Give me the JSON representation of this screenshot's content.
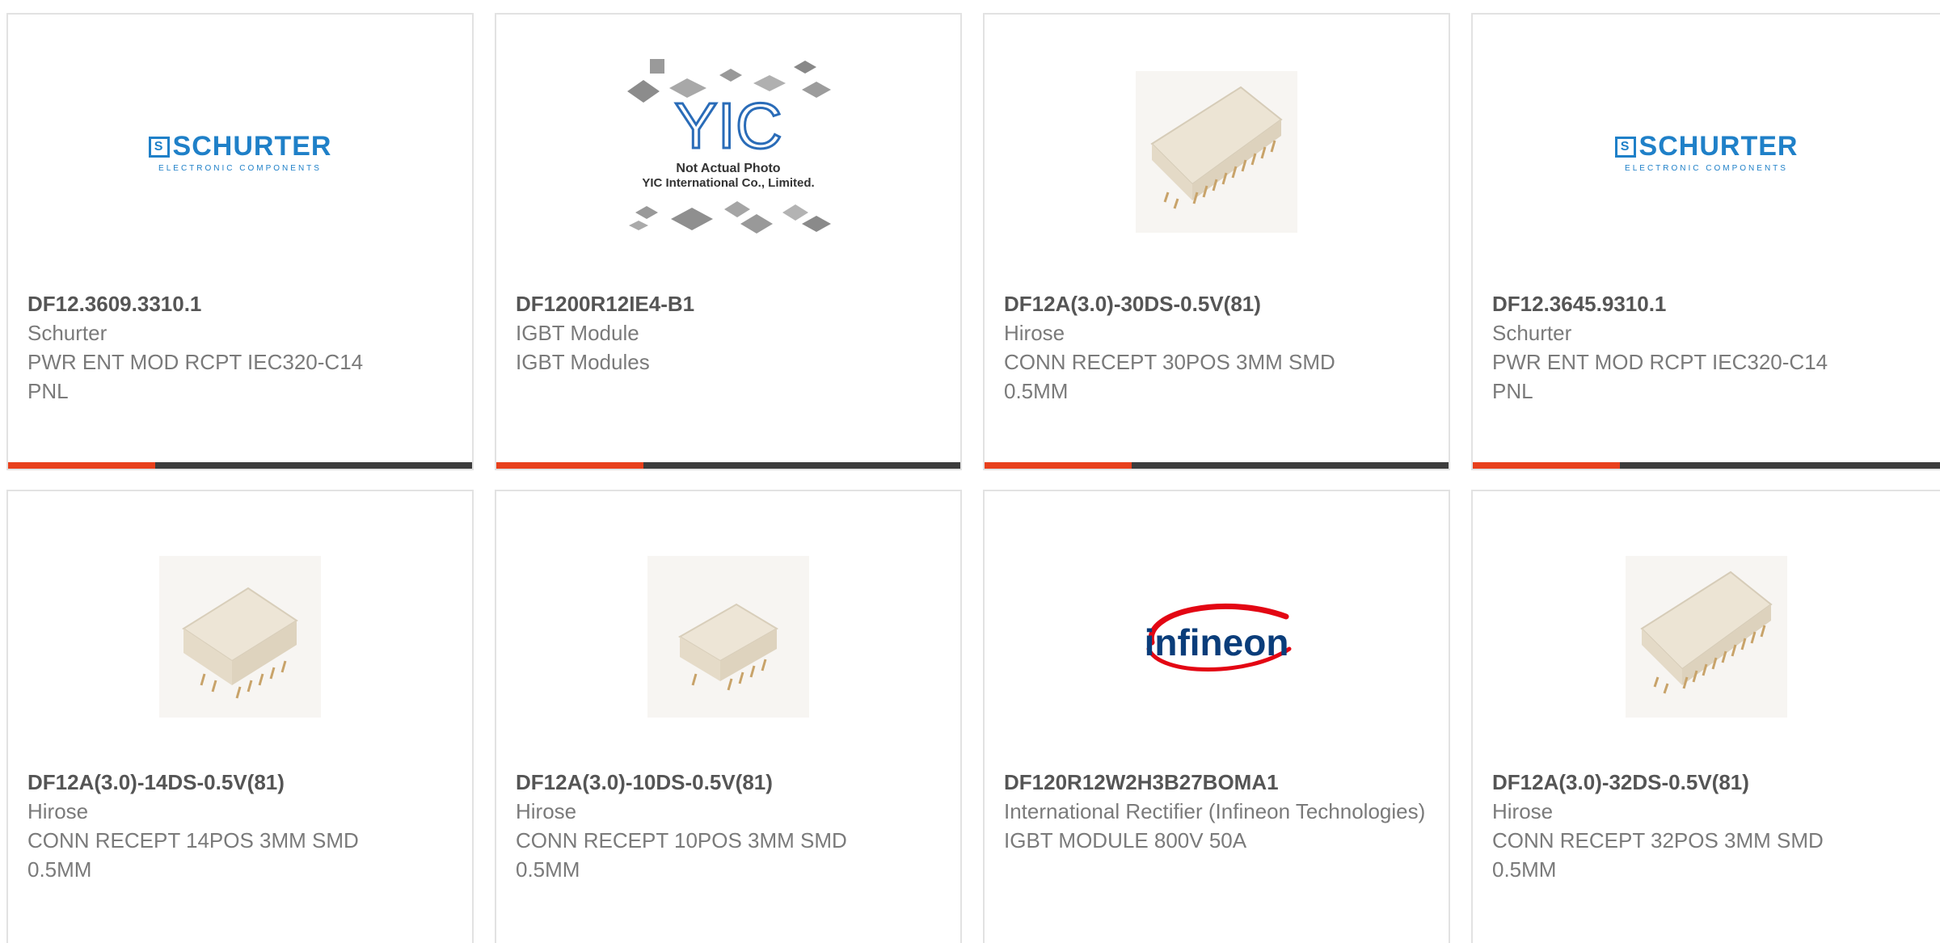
{
  "colors": {
    "accent": "#e8401c",
    "bar": "#3c3c3c",
    "schurter_blue": "#1f80c8",
    "infineon_red": "#e30613",
    "infineon_blue": "#0a3d7a"
  },
  "products": [
    {
      "part_number": "DF12.3609.3310.1",
      "manufacturer": "Schurter",
      "description": "PWR ENT MOD RCPT IEC320-C14 PNL",
      "image": {
        "kind": "logo-schurter",
        "brand": "SCHURTER",
        "tagline": "ELECTRONIC COMPONENTS"
      }
    },
    {
      "part_number": "DF1200R12IE4-B1",
      "manufacturer": "IGBT Module",
      "description": "IGBT Modules",
      "image": {
        "kind": "placeholder-yic",
        "brand": "YIC",
        "line1": "Not Actual Photo",
        "line2": "YIC International Co., Limited."
      }
    },
    {
      "part_number": "DF12A(3.0)-30DS-0.5V(81)",
      "manufacturer": "Hirose",
      "description": "CONN RECEPT 30POS 3MM SMD 0.5MM",
      "image": {
        "kind": "connector-photo",
        "pins": 15
      }
    },
    {
      "part_number": "DF12.3645.9310.1",
      "manufacturer": "Schurter",
      "description": "PWR ENT MOD RCPT IEC320-C14 PNL",
      "image": {
        "kind": "logo-schurter",
        "brand": "SCHURTER",
        "tagline": "ELECTRONIC COMPONENTS"
      }
    },
    {
      "part_number": "DF12A(3.0)-14DS-0.5V(81)",
      "manufacturer": "Hirose",
      "description": "CONN RECEPT 14POS 3MM SMD 0.5MM",
      "image": {
        "kind": "connector-photo",
        "pins": 7
      }
    },
    {
      "part_number": "DF12A(3.0)-10DS-0.5V(81)",
      "manufacturer": "Hirose",
      "description": "CONN RECEPT 10POS 3MM SMD 0.5MM",
      "image": {
        "kind": "connector-photo",
        "pins": 5
      }
    },
    {
      "part_number": "DF120R12W2H3B27BOMA1",
      "manufacturer": "International Rectifier (Infineon Technologies)",
      "description": "IGBT MODULE 800V 50A",
      "image": {
        "kind": "logo-infineon",
        "brand": "infineon"
      }
    },
    {
      "part_number": "DF12A(3.0)-32DS-0.5V(81)",
      "manufacturer": "Hirose",
      "description": "CONN RECEPT 32POS 3MM SMD 0.5MM",
      "image": {
        "kind": "connector-photo",
        "pins": 16
      }
    }
  ]
}
